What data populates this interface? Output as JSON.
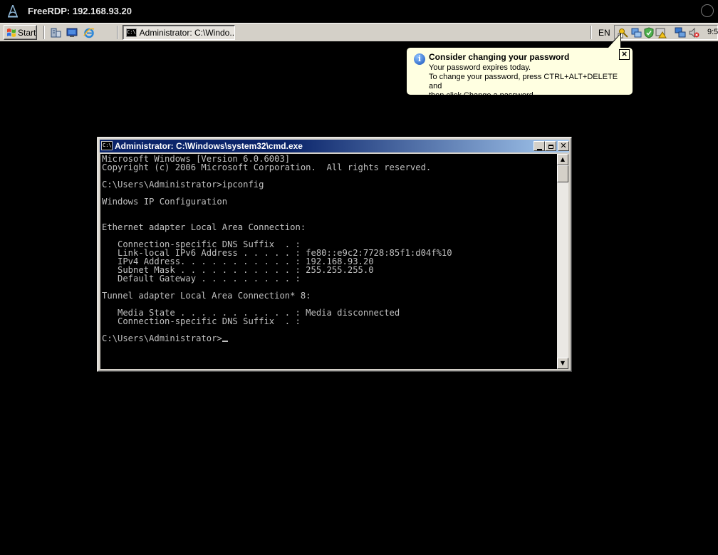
{
  "host": {
    "title": "FreeRDP: 192.168.93.20"
  },
  "taskbar": {
    "start_label": "Start",
    "task_label": "Administrator: C:\\Windo...",
    "language": "EN",
    "clock": "9:5"
  },
  "balloon": {
    "title": "Consider changing your password",
    "lines": [
      "Your password expires today.",
      "To change your password, press CTRL+ALT+DELETE and",
      "then click Change a password."
    ]
  },
  "cmd": {
    "title": "Administrator: C:\\Windows\\system32\\cmd.exe",
    "lines": [
      "Microsoft Windows [Version 6.0.6003]",
      "Copyright (c) 2006 Microsoft Corporation.  All rights reserved.",
      "",
      "C:\\Users\\Administrator>ipconfig",
      "",
      "Windows IP Configuration",
      "",
      "",
      "Ethernet adapter Local Area Connection:",
      "",
      "   Connection-specific DNS Suffix  . :",
      "   Link-local IPv6 Address . . . . . : fe80::e9c2:7728:85f1:d04f%10",
      "   IPv4 Address. . . . . . . . . . . : 192.168.93.20",
      "   Subnet Mask . . . . . . . . . . . : 255.255.255.0",
      "   Default Gateway . . . . . . . . . :",
      "",
      "Tunnel adapter Local Area Connection* 8:",
      "",
      "   Media State . . . . . . . . . . . : Media disconnected",
      "   Connection-specific DNS Suffix  . :",
      ""
    ],
    "prompt": "C:\\Users\\Administrator>"
  },
  "colors": {
    "console_bg": "#000000",
    "console_fg": "#c0c0c0",
    "titlebar_active": "#0a246a",
    "taskbar": "#d4d0c8",
    "balloon_bg": "#ffffe1"
  }
}
